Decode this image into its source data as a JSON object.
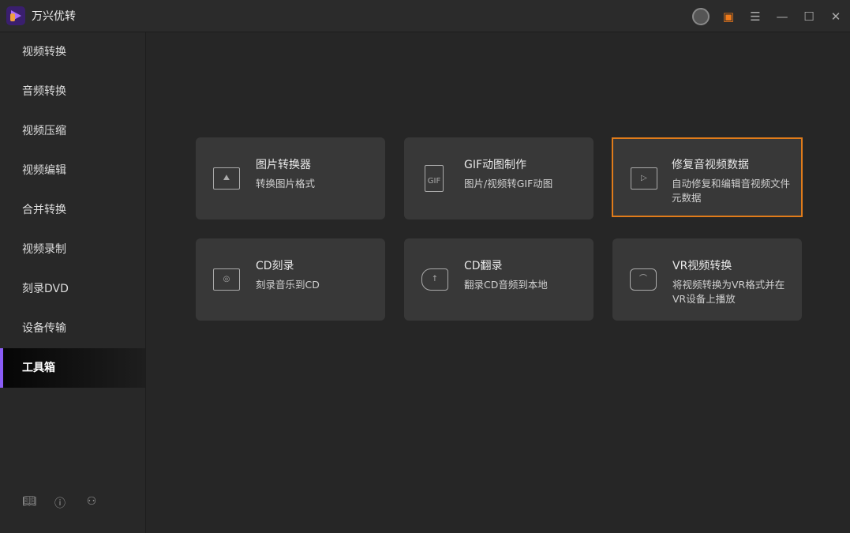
{
  "app": {
    "title": "万兴优转"
  },
  "titlebar": {
    "icons": [
      "account-icon",
      "gift-icon",
      "menu-icon",
      "minimize-icon",
      "maximize-icon",
      "close-icon"
    ]
  },
  "sidebar": {
    "items": [
      {
        "label": "视频转换"
      },
      {
        "label": "音频转换"
      },
      {
        "label": "视频压缩"
      },
      {
        "label": "视频编辑"
      },
      {
        "label": "合并转换"
      },
      {
        "label": "视频录制"
      },
      {
        "label": "刻录DVD"
      },
      {
        "label": "设备传输"
      },
      {
        "label": "工具箱",
        "active": true
      }
    ],
    "footer": [
      "book-icon",
      "help-icon",
      "users-icon"
    ]
  },
  "tools": [
    {
      "title": "图片转换器",
      "desc": "转换图片格式",
      "icon": "image-convert-icon"
    },
    {
      "title": "GIF动图制作",
      "desc": "图片/视频转GIF动图",
      "icon": "gif-icon",
      "icon_text": "GIF"
    },
    {
      "title": "修复音视频数据",
      "desc": "自动修复和编辑音视频文件元数据",
      "icon": "video-info-icon",
      "selected": true
    },
    {
      "title": "CD刻录",
      "desc": "刻录音乐到CD",
      "icon": "cd-burn-icon"
    },
    {
      "title": "CD翻录",
      "desc": "翻录CD音频到本地",
      "icon": "cd-rip-icon"
    },
    {
      "title": "VR视频转换",
      "desc": "将视频转换为VR格式并在VR设备上播放",
      "icon": "vr-icon"
    }
  ],
  "colors": {
    "accent": "#8a5cf6",
    "highlight": "#e07b1a"
  }
}
